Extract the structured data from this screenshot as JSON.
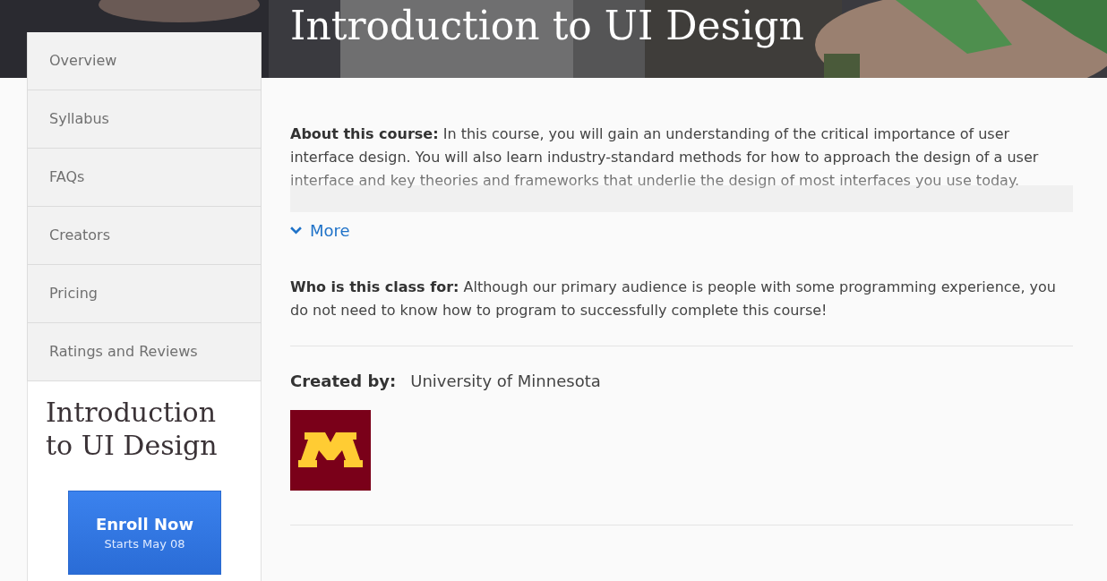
{
  "header": {
    "title": "Introduction to UI Design"
  },
  "sidebar": {
    "items": [
      {
        "label": "Overview"
      },
      {
        "label": "Syllabus"
      },
      {
        "label": "FAQs"
      },
      {
        "label": "Creators"
      },
      {
        "label": "Pricing"
      },
      {
        "label": "Ratings and Reviews"
      }
    ],
    "card": {
      "title": "Introduction to UI Design",
      "enroll_button": {
        "label": "Enroll Now",
        "sublabel": "Starts May 08"
      }
    }
  },
  "about": {
    "text": "**About this course:** In this course, you will gain an understanding of the critical importance of user interface design. You will also learn industry-standard methods for how to approach the design of a user interface and key theories and frameworks that underlie the design of most interfaces you use today."
  },
  "more_link": {
    "label": "More"
  },
  "audience": {
    "text": "**Who is this class for:** Although our primary audience is people with some programming experience, you do not need to know how to program to successfully complete this course!"
  },
  "created_by": {
    "label": "Created by:",
    "name": "University of Minnesota"
  }
}
